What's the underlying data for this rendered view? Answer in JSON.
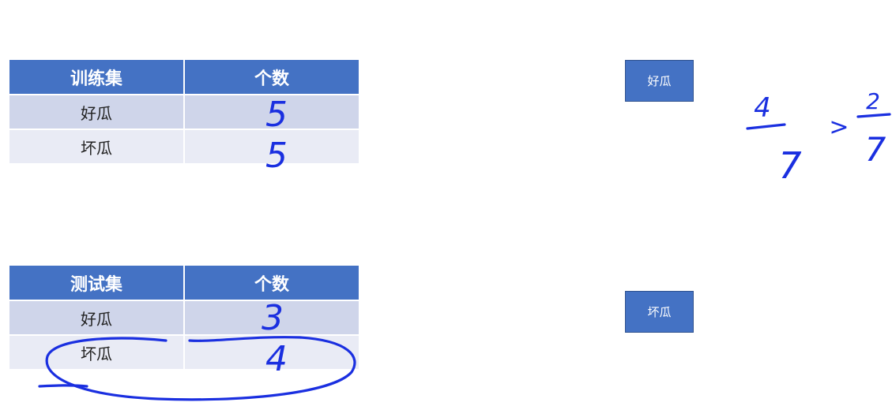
{
  "train_table": {
    "headers": [
      "训练集",
      "个数"
    ],
    "rows": [
      {
        "label": "好瓜",
        "count": "5"
      },
      {
        "label": "坏瓜",
        "count": "5"
      }
    ]
  },
  "test_table": {
    "headers": [
      "测试集",
      "个数"
    ],
    "rows": [
      {
        "label": "好瓜",
        "count": "3"
      },
      {
        "label": "坏瓜",
        "count": "4"
      }
    ]
  },
  "class_boxes": {
    "good": "好瓜",
    "bad": "坏瓜"
  },
  "handwriting": {
    "left_numerator": "4",
    "left_denominator": "7",
    "comparator": ">",
    "right_numerator": "2",
    "right_denominator": "7"
  },
  "colors": {
    "header": "#4472c4",
    "row_odd": "#cfd5ea",
    "row_even": "#e9ebf5",
    "ink": "#1a2fe0"
  }
}
